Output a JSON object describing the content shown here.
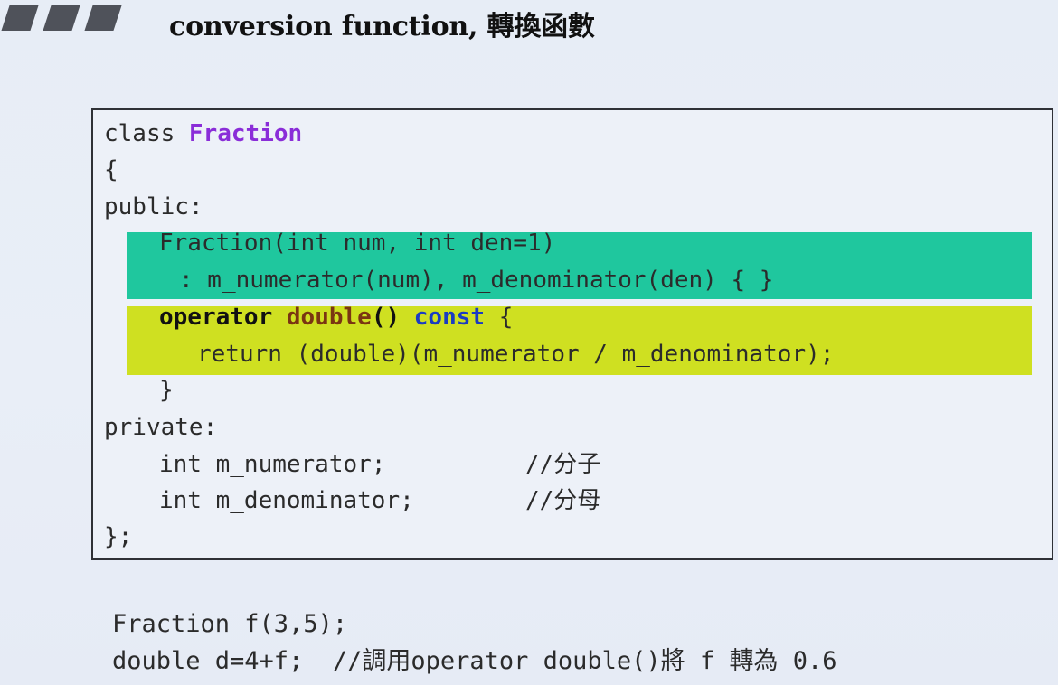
{
  "slide": {
    "title": "conversion function, 轉換函數"
  },
  "code": {
    "line1_keyword": "class ",
    "line1_class_name": "Fraction",
    "line2": "{",
    "line3": "public:",
    "line4": "Fraction(int num, int den=1)",
    "line5": ": m_numerator(num), m_denominator(den) { }",
    "line6_kw_operator": "operator",
    "line6_type": " double",
    "line6_parens": "()",
    "line6_const": " const",
    "line6_brace": " {",
    "line7": "return (double)(m_numerator / m_denominator);",
    "line8": "}",
    "line9": "private:",
    "line10_decl": "int m_numerator;",
    "line10_comment": "//分子",
    "line11_decl": "int m_denominator;",
    "line11_comment": "//分母",
    "line12": "};"
  },
  "usage": {
    "line1": "Fraction f(3,5);",
    "line2": "double d=4+f;  //調用operator double()將 f 轉為 0.6"
  },
  "colors": {
    "green_highlight": "#1fc79e",
    "yellow_highlight": "#cfe021",
    "class_name": "#8a2dd8",
    "operator_keyword": "#111111",
    "double_keyword": "#7a3512",
    "const_keyword": "#1a3cc2"
  }
}
